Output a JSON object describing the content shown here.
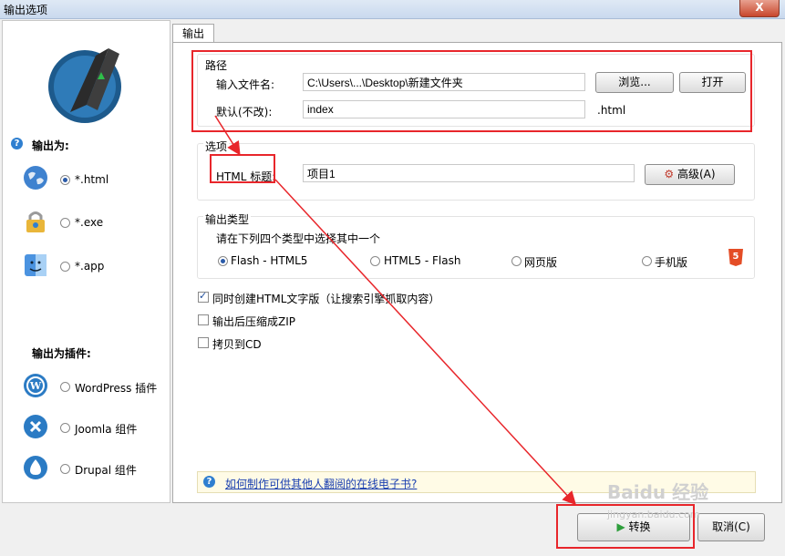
{
  "window": {
    "title": "输出选项",
    "close_label": "X"
  },
  "left": {
    "output_as_title": "输出为:",
    "formats": [
      {
        "label": "*.html",
        "icon": "globe-icon",
        "checked": true
      },
      {
        "label": "*.exe",
        "icon": "lock-icon",
        "checked": false
      },
      {
        "label": "*.app",
        "icon": "mac-finder-icon",
        "checked": false
      }
    ],
    "plugins_title": "输出为插件:",
    "plugins": [
      {
        "label": "WordPress 插件",
        "icon": "wordpress-icon"
      },
      {
        "label": "Joomla 组件",
        "icon": "joomla-icon"
      },
      {
        "label": "Drupal 组件",
        "icon": "drupal-icon"
      }
    ]
  },
  "tab": {
    "label": "输出"
  },
  "path_group": {
    "title": "路径",
    "filename_label": "输入文件名:",
    "filename_value": "C:\\Users\\...\\Desktop\\新建文件夹",
    "browse_label": "浏览...",
    "open_label": "打开",
    "default_label": "默认(不改):",
    "default_value": "index",
    "ext": ".html"
  },
  "options_group": {
    "title": "选项",
    "html_title_label": "HTML 标题:",
    "html_title_value": "项目1",
    "advanced_label": "高级(A)"
  },
  "type_group": {
    "title": "输出类型",
    "hint": "请在下列四个类型中选择其中一个",
    "types": [
      {
        "label": "Flash - HTML5",
        "checked": true
      },
      {
        "label": "HTML5 - Flash",
        "checked": false
      },
      {
        "label": "网页版",
        "checked": false
      },
      {
        "label": "手机版",
        "checked": false
      }
    ],
    "html5_badge": "5"
  },
  "checks": [
    {
      "label": "同时创建HTML文字版（让搜索引擎抓取内容）",
      "checked": true
    },
    {
      "label": "输出后压缩成ZIP",
      "checked": false
    },
    {
      "label": "拷贝到CD",
      "checked": false
    }
  ],
  "help": {
    "link": "如何制作可供其他人翻阅的在线电子书?"
  },
  "footer": {
    "convert_label": "转换",
    "cancel_label": "取消(C)"
  },
  "watermark": {
    "main": "Baidu 经验",
    "sub": "jingyan.baidu.com"
  },
  "colors": {
    "annotation_red": "#e8262b",
    "panel_border": "#a9a9a9"
  }
}
